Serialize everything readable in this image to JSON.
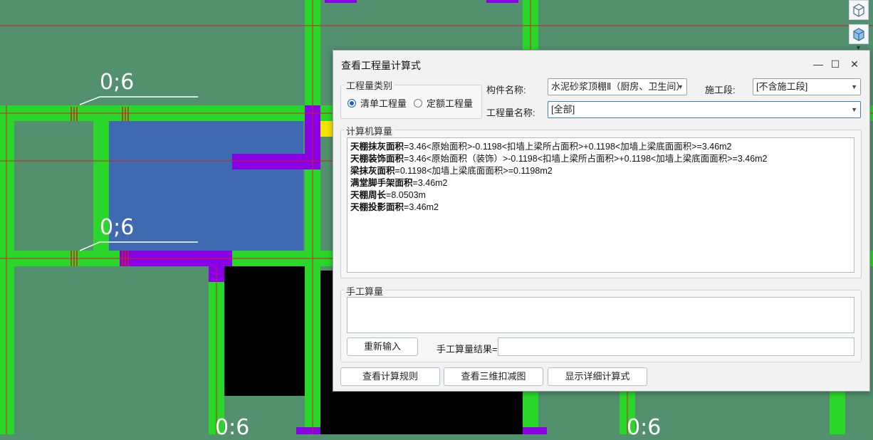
{
  "canvas": {
    "labels": [
      "0;6",
      "0;6",
      "0:6",
      "0:6"
    ],
    "colors": {
      "floor": "#52906e",
      "wall": "#2bd62b",
      "beam_line": "#cc2222",
      "room": "#3f69b0",
      "purple": "#8a00e6",
      "black": "#000000",
      "yellow": "#f5e400"
    }
  },
  "side_toolbar": {
    "icons": [
      "cube-icon",
      "cube-filled-icon"
    ]
  },
  "dialog": {
    "title": "查看工程量计算式",
    "controls": {
      "minimize": "—",
      "maximize": "☐",
      "close": "✕"
    },
    "category": {
      "legend": "工程量类别",
      "options": [
        {
          "label": "清单工程量",
          "selected": true
        },
        {
          "label": "定额工程量",
          "selected": false
        }
      ]
    },
    "component_label": "构件名称:",
    "component_value": "水泥砂浆顶棚Ⅱ（厨房、卫生间）",
    "stage_label": "施工段:",
    "stage_value": "[不含施工段]",
    "quantity_label": "工程量名称:",
    "quantity_value": "[全部]",
    "computer": {
      "legend": "计算机算量",
      "lines": [
        {
          "name": "天棚抹灰面积",
          "expr": "=3.46<原始面积>-0.1198<扣墙上梁所占面积>+0.1198<加墙上梁底面面积>=3.46m2"
        },
        {
          "name": "天棚装饰面积",
          "expr": "=3.46<原始面积（装饰）>-0.1198<扣墙上梁所占面积>+0.1198<加墙上梁底面面积>=3.46m2"
        },
        {
          "name": "梁抹灰面积",
          "expr": "=0.1198<加墙上梁底面面积>=0.1198m2"
        },
        {
          "name": "满堂脚手架面积",
          "expr": "=3.46m2"
        },
        {
          "name": "天棚周长",
          "expr": "=8.0503m"
        },
        {
          "name": "天棚投影面积",
          "expr": "=3.46m2"
        }
      ]
    },
    "manual": {
      "legend": "手工算量",
      "reenter_button": "重新输入",
      "result_label": "手工算量结果=",
      "result_value": ""
    },
    "buttons": {
      "rules": "查看计算规则",
      "view3d": "查看三维扣减图",
      "detail": "显示详细计算式"
    }
  }
}
